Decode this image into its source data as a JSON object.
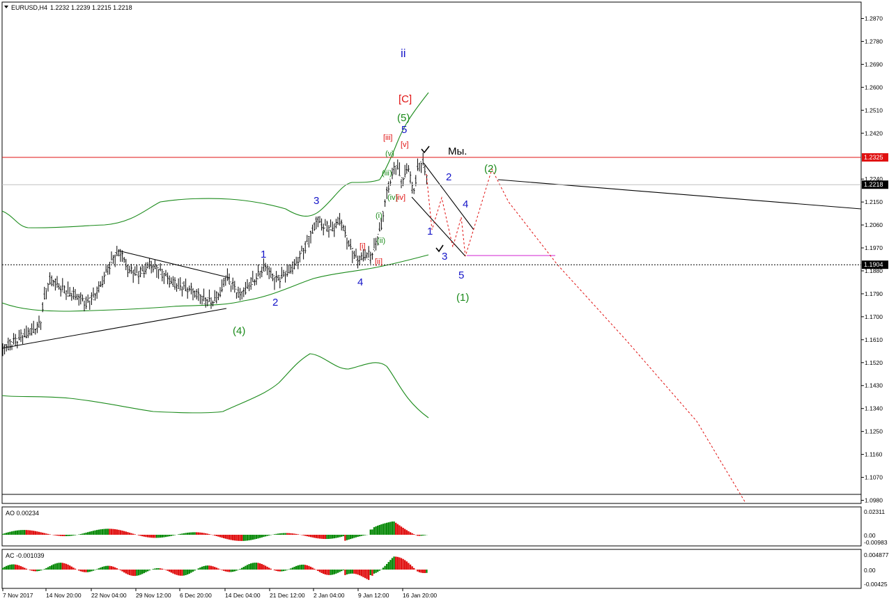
{
  "header": {
    "symbol": "EURUSD,H4",
    "ohlc": "1.2232 1.2239 1.2215 1.2218"
  },
  "indicators": {
    "ao_label": "AO 0.00234",
    "ac_label": "AC -0.001039",
    "ao_ticks": [
      "0.02311",
      "0.00",
      "-0.00983"
    ],
    "ac_ticks": [
      "0.004877",
      "0.00",
      "-0.00425"
    ]
  },
  "price_tags": {
    "red": "1.2325",
    "current": "1.2218",
    "dotted": "1.1904"
  },
  "colors": {
    "wave_blue": "#1414c8",
    "wave_green": "#1a8a1a",
    "wave_red": "#e01010",
    "envelope": "#1a8a1a",
    "red_level": "#e01010",
    "target_line": "#d020d0",
    "ao_up": "#0a8a0a",
    "ao_down": "#e01010"
  },
  "chart_data": {
    "type": "candlestick",
    "symbol": "EURUSD",
    "timeframe": "H4",
    "ylim": [
      1.098,
      1.2915
    ],
    "yticks": [
      "1.2870",
      "1.2780",
      "1.2690",
      "1.2600",
      "1.2510",
      "1.2420",
      "1.2240",
      "1.2150",
      "1.2060",
      "1.1970",
      "1.1880",
      "1.1790",
      "1.1700",
      "1.1610",
      "1.1520",
      "1.1430",
      "1.1340",
      "1.1250",
      "1.1160",
      "1.1070",
      "1.0980"
    ],
    "xticks": [
      "7 Nov 2017",
      "14 Nov 20:00",
      "22 Nov 04:00",
      "29 Nov 12:00",
      "6 Dec 20:00",
      "14 Dec 04:00",
      "21 Dec 12:00",
      "2 Jan 04:00",
      "9 Jan 12:00",
      "16 Jan 20:00"
    ],
    "levels": {
      "red_horizontal": 1.2325,
      "current_price": 1.2218,
      "dotted_support": 1.1904,
      "magenta_target": 1.1935
    },
    "wave_labels": [
      {
        "text": "ii",
        "color": "blue"
      },
      {
        "text": "[C]",
        "color": "red"
      },
      {
        "text": "(5)",
        "color": "green"
      },
      {
        "text": "5",
        "color": "blue"
      },
      {
        "text": "[iii]",
        "color": "red"
      },
      {
        "text": "[v]",
        "color": "red"
      },
      {
        "text": "(v)",
        "color": "green"
      },
      {
        "text": "(iii)",
        "color": "green"
      },
      {
        "text": "(iv)",
        "color": "green"
      },
      {
        "text": "[iv]",
        "color": "red"
      },
      {
        "text": "(i)",
        "color": "green"
      },
      {
        "text": "(ii)",
        "color": "green"
      },
      {
        "text": "[i]",
        "color": "red"
      },
      {
        "text": "[ii]",
        "color": "red"
      },
      {
        "text": "3",
        "color": "blue"
      },
      {
        "text": "1",
        "color": "blue"
      },
      {
        "text": "2",
        "color": "blue"
      },
      {
        "text": "4",
        "color": "blue"
      },
      {
        "text": "(4)",
        "color": "green"
      },
      {
        "text": "2",
        "color": "blue"
      },
      {
        "text": "4",
        "color": "blue"
      },
      {
        "text": "1",
        "color": "blue"
      },
      {
        "text": "3",
        "color": "blue"
      },
      {
        "text": "5",
        "color": "blue"
      },
      {
        "text": "(1)",
        "color": "green"
      },
      {
        "text": "(2)",
        "color": "green"
      },
      {
        "text": "Мы.",
        "color": "black"
      }
    ]
  }
}
